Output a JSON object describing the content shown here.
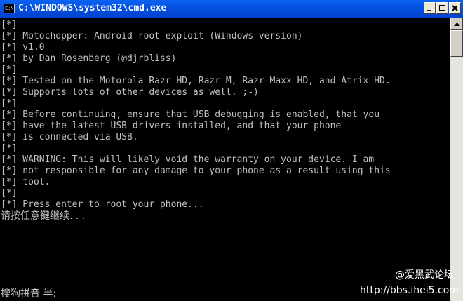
{
  "window": {
    "title": "C:\\WINDOWS\\system32\\cmd.exe",
    "icon_label": "C:\\",
    "icon": "cmd-icon"
  },
  "controls": {
    "minimize_icon": "minimize-icon",
    "maximize_icon": "maximize-icon",
    "close_icon": "close-icon"
  },
  "console_lines": [
    "[*]",
    "[*] Motochopper: Android root exploit (Windows version)",
    "[*] v1.0",
    "[*] by Dan Rosenberg (@djrbliss)",
    "[*]",
    "[*] Tested on the Motorola Razr HD, Razr M, Razr Maxx HD, and Atrix HD.",
    "[*] Supports lots of other devices as well. ;-)",
    "[*]",
    "[*] Before continuing, ensure that USB debugging is enabled, that you",
    "[*] have the latest USB drivers installed, and that your phone",
    "[*] is connected via USB.",
    "[*]",
    "[*] WARNING: This will likely void the warranty on your device. I am",
    "[*] not responsible for any damage to your phone as a result using this",
    "[*] tool.",
    "[*]",
    "[*] Press enter to root your phone...",
    "请按任意键继续. . ."
  ],
  "ime_status": "搜狗拼音 半:",
  "watermark": {
    "line1": "@爱黑武论坛",
    "line2": "http://bbs.ihei5.com"
  },
  "colors": {
    "titlebar": "#0553e0",
    "console_bg": "#000000",
    "console_text": "#c0c0c0"
  }
}
